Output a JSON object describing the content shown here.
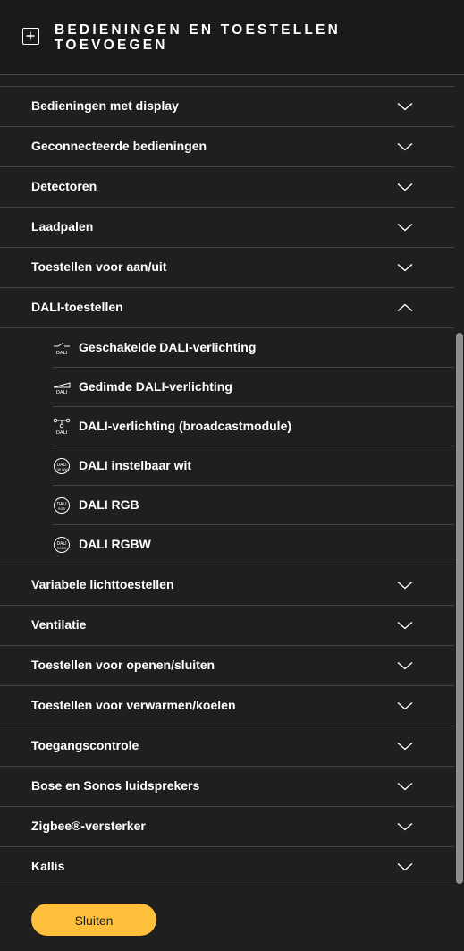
{
  "header": {
    "title": "BEDIENINGEN EN TOESTELLEN TOEVOEGEN"
  },
  "categories_top": [
    {
      "label": "Bedieningen met display"
    },
    {
      "label": "Geconnecteerde bedieningen"
    },
    {
      "label": "Detectoren"
    },
    {
      "label": "Laadpalen"
    },
    {
      "label": "Toestellen voor aan/uit"
    }
  ],
  "expanded": {
    "label": "DALI-toestellen",
    "items": [
      {
        "label": "Geschakelde DALI-verlichting",
        "icon": "dali-switched-icon"
      },
      {
        "label": "Gedimde DALI-verlichting",
        "icon": "dali-dimmed-icon"
      },
      {
        "label": "DALI-verlichting (broadcastmodule)",
        "icon": "dali-broadcast-icon"
      },
      {
        "label": "DALI instelbaar wit",
        "icon": "dali-cwww-icon"
      },
      {
        "label": "DALI RGB",
        "icon": "dali-rgb-icon"
      },
      {
        "label": "DALI RGBW",
        "icon": "dali-rgbw-icon"
      }
    ]
  },
  "categories_bottom": [
    {
      "label": "Variabele lichttoestellen"
    },
    {
      "label": "Ventilatie"
    },
    {
      "label": "Toestellen voor openen/sluiten"
    },
    {
      "label": "Toestellen voor verwarmen/koelen"
    },
    {
      "label": "Toegangscontrole"
    },
    {
      "label": "Bose en Sonos luidsprekers"
    },
    {
      "label": "Zigbee®-versterker"
    },
    {
      "label": "Kallis"
    }
  ],
  "footer": {
    "close_label": "Sluiten"
  },
  "colors": {
    "accent": "#fec03a",
    "background": "#1f1f1f",
    "divider": "#444444"
  },
  "icons": {
    "dali": "DALI",
    "cwww": "CW WW",
    "rgb": "RGB",
    "rgbw": "RGBW"
  }
}
